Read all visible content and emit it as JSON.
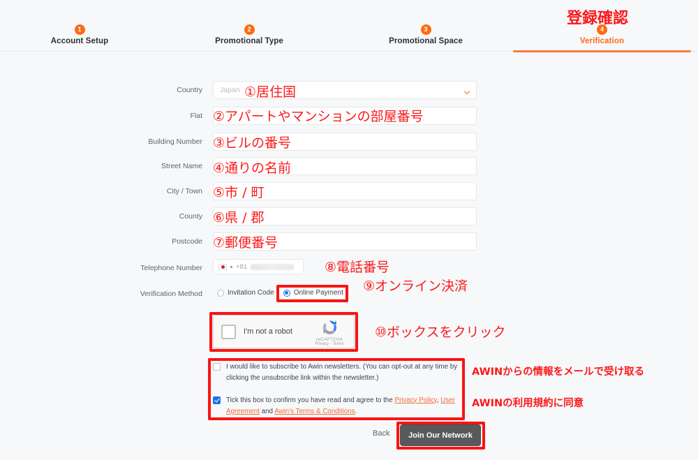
{
  "stepper": {
    "steps": [
      {
        "num": "1",
        "label": "Account Setup",
        "active": false
      },
      {
        "num": "2",
        "label": "Promotional Type",
        "active": false
      },
      {
        "num": "3",
        "label": "Promotional Space",
        "active": false
      },
      {
        "num": "4",
        "label": "Verification",
        "active": true
      }
    ]
  },
  "form": {
    "country": {
      "label": "Country",
      "value": "Japan"
    },
    "flat": {
      "label": "Flat",
      "value": ""
    },
    "building_number": {
      "label": "Building Number",
      "value": ""
    },
    "street_name": {
      "label": "Street Name",
      "value": ""
    },
    "city_town": {
      "label": "City / Town",
      "value": ""
    },
    "county": {
      "label": "County",
      "value": ""
    },
    "postcode": {
      "label": "Postcode",
      "value": ""
    },
    "telephone": {
      "label": "Telephone Number",
      "dial_code": "+81",
      "value": ""
    },
    "verification_method": {
      "label": "Verification Method",
      "options": [
        {
          "label": "Invitation Code",
          "selected": false
        },
        {
          "label": "Online Payment",
          "selected": true
        }
      ]
    }
  },
  "recaptcha": {
    "checkbox_label": "I'm not a robot",
    "brand": "reCAPTCHA",
    "terms": "Privacy - Terms",
    "checked": false
  },
  "consents": {
    "newsletter": {
      "checked": false,
      "text": "I would like to subscribe to Awin newsletters. (You can opt-out at any time by clicking the unsubscribe link within the newsletter.)"
    },
    "terms": {
      "checked": true,
      "prefix": "Tick this box to confirm you have read and agree to the ",
      "link1": "Privacy Policy",
      "sep1": ", ",
      "link2": "User Agreement",
      "sep2": " and ",
      "link3": "Awin's Terms & Conditions",
      "suffix": "."
    }
  },
  "footer": {
    "back_label": "Back",
    "submit_label": "Join Our Network"
  },
  "annotations": {
    "title": "登録確認",
    "a1": "①居住国",
    "a2": "②アパートやマンションの部屋番号",
    "a3": "③ビルの番号",
    "a4": "④通りの名前",
    "a5": "⑤市 / 町",
    "a6": "⑥県 / 郡",
    "a7": "⑦郵便番号",
    "a8": "⑧電話番号",
    "a9": "⑨オンライン決済",
    "a10": "⑩ボックスをクリック",
    "a11": "AWINからの情報をメールで受け取る",
    "a12": "AWINの利用規約に同意"
  },
  "colors": {
    "accent": "#ff6a13",
    "annotation": "#fb1a1a",
    "link": "#f06a38",
    "radio_selected": "#1a73e8"
  }
}
